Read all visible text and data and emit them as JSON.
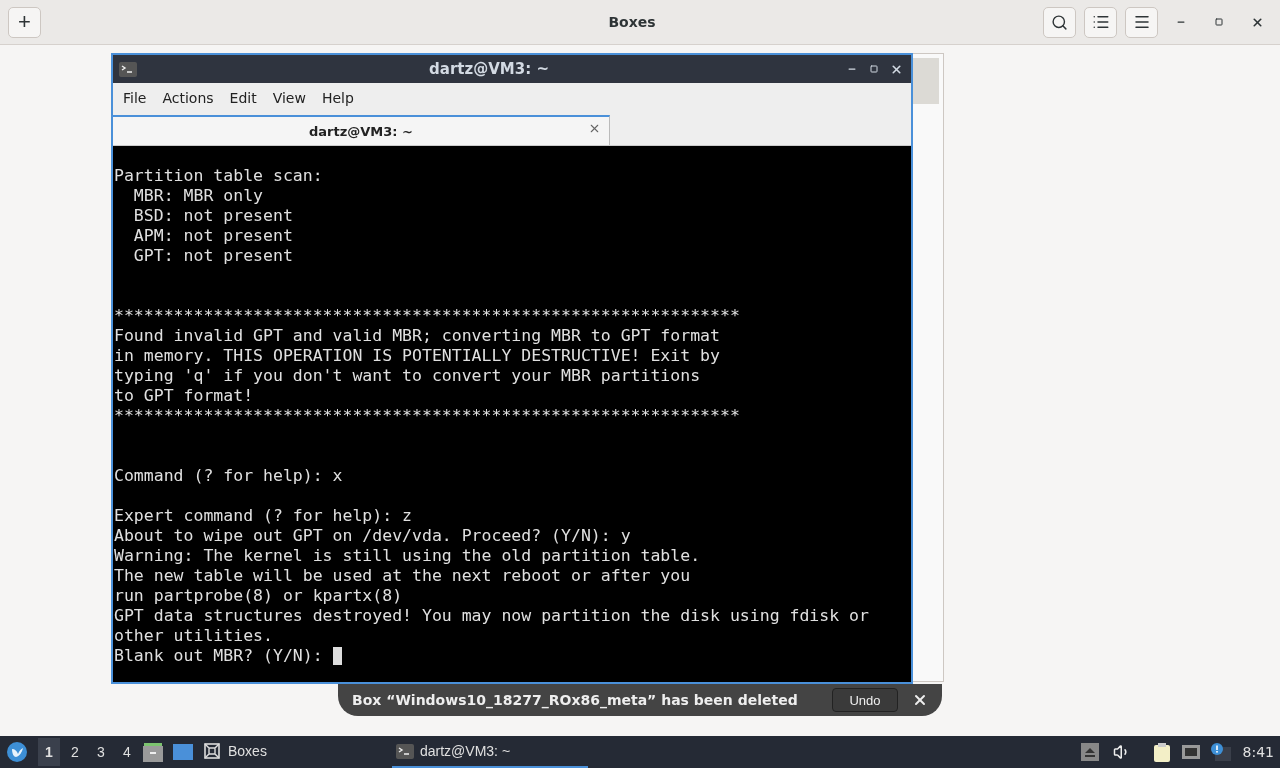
{
  "app": {
    "title": "Boxes",
    "add_label": "+"
  },
  "terminal": {
    "title": "dartz@VM3: ~",
    "menu": [
      "File",
      "Actions",
      "Edit",
      "View",
      "Help"
    ],
    "tabs": [
      {
        "label": "dartz@VM3: ~",
        "selected": true
      }
    ],
    "output": "Partition table scan:\n  MBR: MBR only\n  BSD: not present\n  APM: not present\n  GPT: not present\n\n\n***************************************************************\nFound invalid GPT and valid MBR; converting MBR to GPT format\nin memory. THIS OPERATION IS POTENTIALLY DESTRUCTIVE! Exit by\ntyping 'q' if you don't want to convert your MBR partitions\nto GPT format!\n***************************************************************\n\n\nCommand (? for help): x\n\nExpert command (? for help): z\nAbout to wipe out GPT on /dev/vda. Proceed? (Y/N): y\nWarning: The kernel is still using the old partition table.\nThe new table will be used at the next reboot or after you\nrun partprobe(8) or kpartx(8)\nGPT data structures destroyed! You may now partition the disk using fdisk or\nother utilities.",
    "prompt": "Blank out MBR? (Y/N): "
  },
  "toast": {
    "message": "Box “Windows10_18277_ROx86_meta” has been deleted",
    "action": "Undo"
  },
  "taskbar": {
    "workspaces": [
      {
        "label": "1",
        "selected": true
      },
      {
        "label": "2",
        "selected": false
      },
      {
        "label": "3",
        "selected": false
      },
      {
        "label": "4",
        "selected": false
      }
    ],
    "tasks": [
      {
        "label": "Boxes",
        "kind": "boxes",
        "selected": false
      },
      {
        "label": "dartz@VM3: ~",
        "kind": "terminal",
        "selected": true
      }
    ],
    "clock": "8:41"
  }
}
